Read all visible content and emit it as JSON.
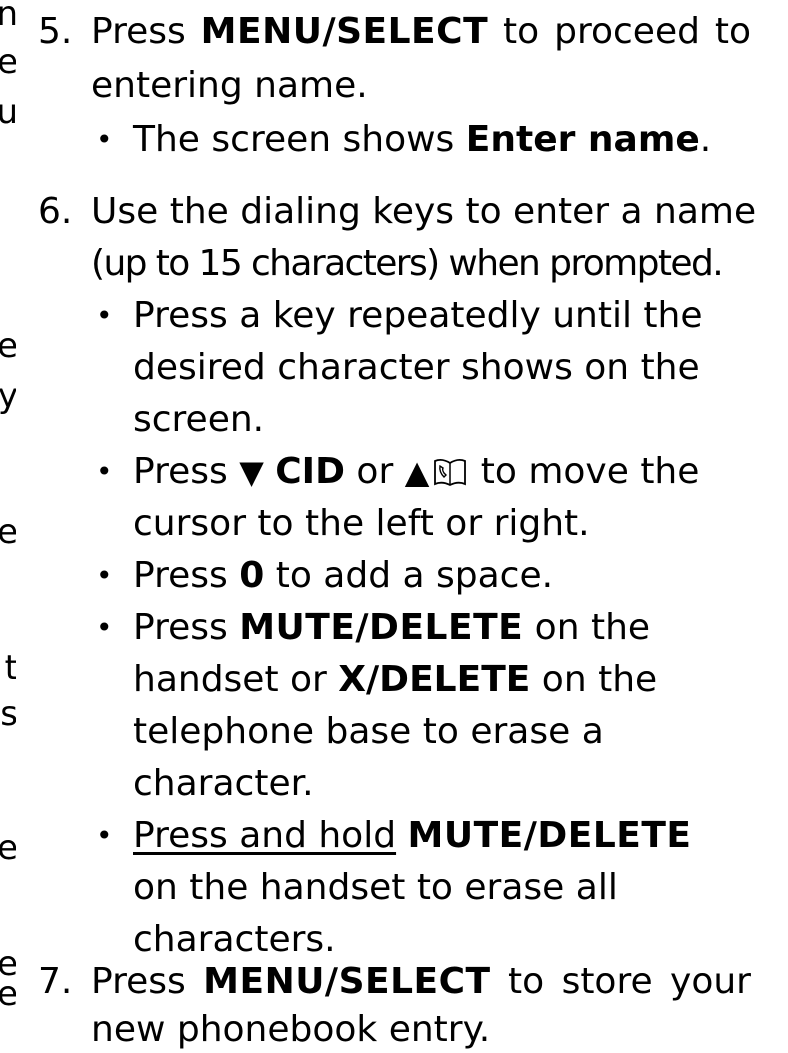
{
  "step5": {
    "number": "5.",
    "l1_pre": "Press",
    "l1_key": "MENU/SELECT",
    "l1_w1": "to",
    "l1_w2": "proceed",
    "l1_w3": "to",
    "l2": "entering name.",
    "b1_pre": "The screen shows ",
    "b1_bold": "Enter name",
    "b1_post": "."
  },
  "step6": {
    "number": "6.",
    "l1": "Use the dialing keys to enter a name",
    "l2": "(up to 15 characters) when prompted.",
    "b1_l1": "Press a key repeatedly until the",
    "b1_l2": "desired character shows on the",
    "b1_l3": "screen.",
    "b2_pre": "Press ",
    "b2_down": "▼",
    "b2_cid": "CID",
    "b2_or": " or ",
    "b2_up": "▲",
    "b2_post": " to move the",
    "b2_l2": "cursor to the left or right.",
    "b3_pre": "Press ",
    "b3_key": "0",
    "b3_post": " to add a space.",
    "b4_pre": "Press ",
    "b4_key": "MUTE/DELETE",
    "b4_post": " on the",
    "b4_l2_pre": "handset or ",
    "b4_l2_key": "X/DELETE",
    "b4_l2_post": " on the",
    "b4_l3": "telephone base to erase a",
    "b4_l4": "character.",
    "b5_u": "Press and hold",
    "b5_key": "MUTE/DELETE",
    "b5_l2": "on the handset to erase all",
    "b5_l3": "characters."
  },
  "step7": {
    "number": "7.",
    "l1_pre": "Press",
    "l1_key": "MENU/SELECT",
    "l1_w1": "to",
    "l1_w2": "store",
    "l1_w3": "your",
    "l2": "new phonebook entry."
  },
  "bullet": "•",
  "left_edge_fragments": [
    "n",
    "e",
    "u",
    "e",
    "y",
    "e",
    "t",
    "s",
    "e",
    "e",
    "e"
  ]
}
